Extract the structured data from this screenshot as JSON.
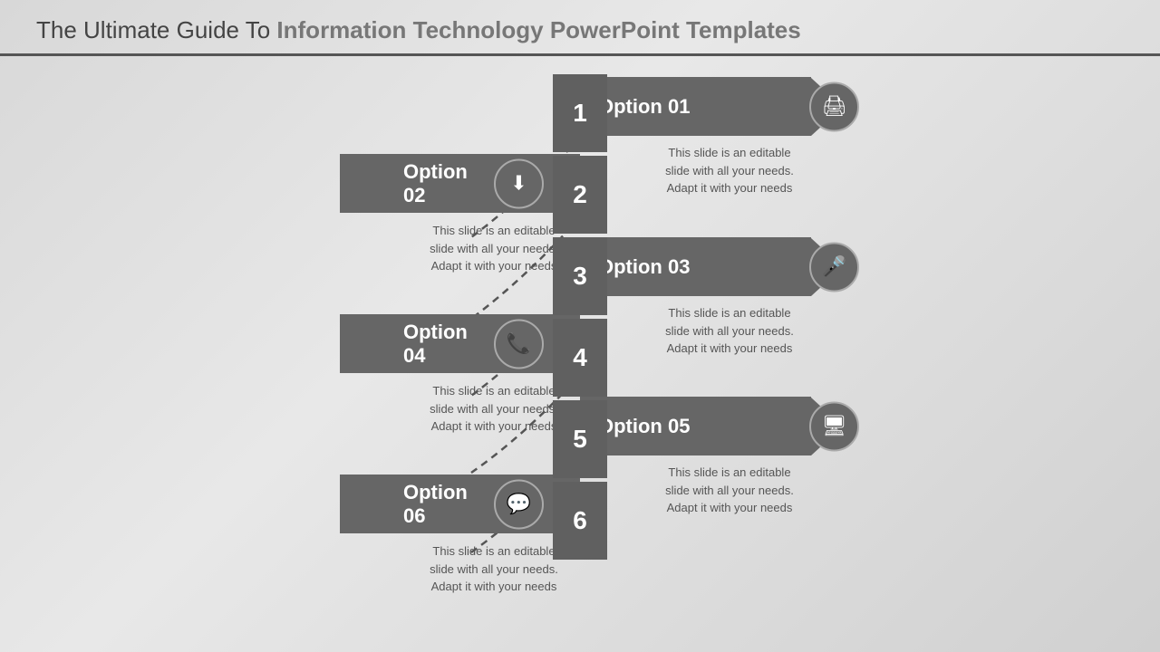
{
  "header": {
    "prefix": "The Ultimate Guide To ",
    "highlight": "Information Technology PowerPoint Templates",
    "underline_color": "#555555"
  },
  "steps": [
    {
      "number": "1",
      "label": "Option 01",
      "icon": "🖨",
      "side": "right",
      "description": "This slide is an editable slide with all your needs. Adapt it with your needs"
    },
    {
      "number": "2",
      "label": "Option 02",
      "icon": "⬇",
      "side": "left",
      "description": "This slide is an editable slide with all your needs. Adapt it with your needs"
    },
    {
      "number": "3",
      "label": "Option 03",
      "icon": "🎤",
      "side": "right",
      "description": "This slide is an editable slide with all your needs. Adapt it with your needs"
    },
    {
      "number": "4",
      "label": "Option 04",
      "icon": "📞",
      "side": "left",
      "description": "This slide is an editable slide with all your needs. Adapt it with your needs"
    },
    {
      "number": "5",
      "label": "Option 05",
      "icon": "🖥",
      "side": "right",
      "description": "This slide is an editable slide with all your needs. Adapt it with your needs"
    },
    {
      "number": "6",
      "label": "Option 06",
      "icon": "💬",
      "side": "left",
      "description": "This slide is an editable slide with all your needs. Adapt it with your needs"
    }
  ],
  "colors": {
    "arrow_bg": "#666666",
    "accent": "#555555",
    "text": "#555555",
    "white": "#ffffff"
  }
}
